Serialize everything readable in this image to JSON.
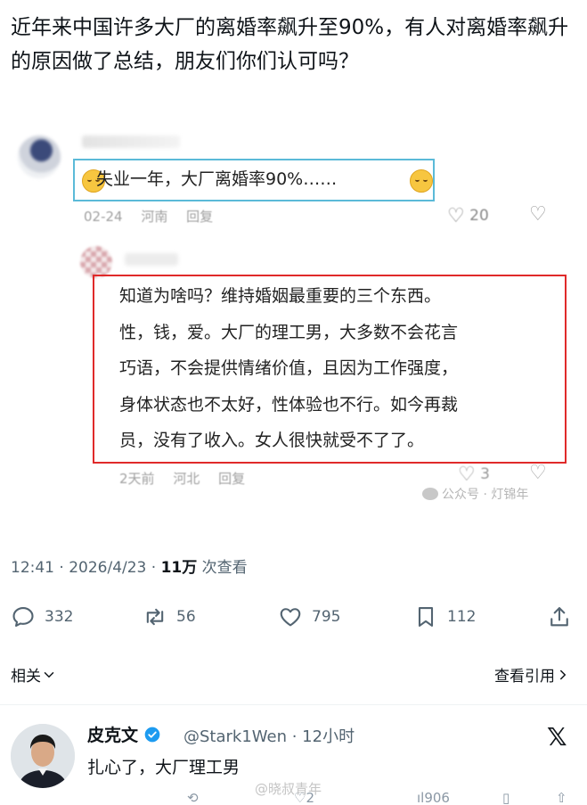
{
  "post": {
    "text": "近年来中国许多大厂的离婚率飙升至90%，有人对离婚率飙升的原因做了总结，朋友们你们认可吗？"
  },
  "screenshot": {
    "comment1": {
      "text": "失业一年，大厂离婚率90%……",
      "date": "02-24",
      "location": "河南",
      "reply": "回复",
      "likes": "20"
    },
    "comment2": {
      "lines": [
        "知道为啥吗？维持婚姻最重要的三个东西。",
        "性，钱，爱。大厂的理工男，大多数不会花言",
        "巧语，不会提供情绪价值，且因为工作强度，",
        "身体状态也不太好，性体验也不行。如今再裁",
        "员，没有了收入。女人很快就受不了了。"
      ],
      "date": "2天前",
      "location": "河北",
      "reply": "回复",
      "likes": "3"
    },
    "watermark": "公众号 · 灯锦年"
  },
  "meta": {
    "time": "12:41 · 2026/4/23 · ",
    "views_count": "11万",
    "views_label": " 次查看"
  },
  "actions": {
    "replies": "332",
    "reposts": "56",
    "likes": "795",
    "bookmarks": "112"
  },
  "related": {
    "left_label": "相关",
    "right_label": "查看引用"
  },
  "reply": {
    "name": "皮克文",
    "handle": "@Stark1Wen · 12小时",
    "text": "扎心了，大厂理工男",
    "replies": "",
    "likes": "2",
    "views": "906"
  },
  "weibo_watermark": "@晓叔青年",
  "colors": {
    "comment1_border": "#5bbad8",
    "comment2_border": "#e02a2a",
    "verified": "#1d9bf0"
  }
}
